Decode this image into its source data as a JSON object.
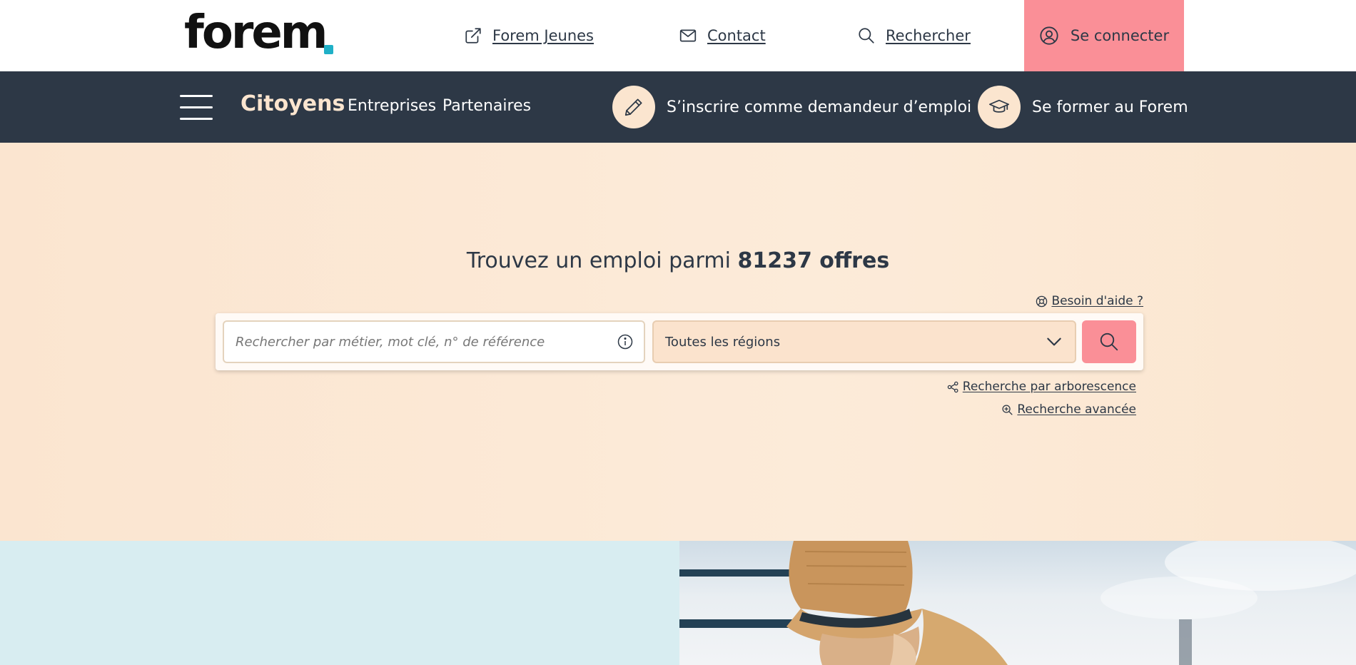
{
  "header": {
    "logo_text": "forem",
    "logo_dot_color": "#1fb0c7",
    "links": {
      "jeunes": "Forem Jeunes",
      "contact": "Contact",
      "search": "Rechercher"
    },
    "connect_label": "Se connecter",
    "connect_color": "#fa8f97"
  },
  "nav": {
    "background": "#2d3846",
    "items": {
      "citoyens": "Citoyens",
      "entreprises": "Entreprises",
      "partenaires": "Partenaires"
    },
    "cta_register": "S’inscrire comme demandeur d’emploi",
    "cta_training": "Se former au Forem"
  },
  "hero": {
    "title_prefix": "Trouvez un emploi parmi",
    "offer_count": "81237 offres",
    "help_link": "Besoin d'aide ?",
    "search_placeholder": "Rechercher par métier, mot clé, n° de référence",
    "region_selected": "Toutes les régions",
    "tree_search_link": "Recherche par arborescence",
    "advanced_search_link": "Recherche avancée"
  }
}
